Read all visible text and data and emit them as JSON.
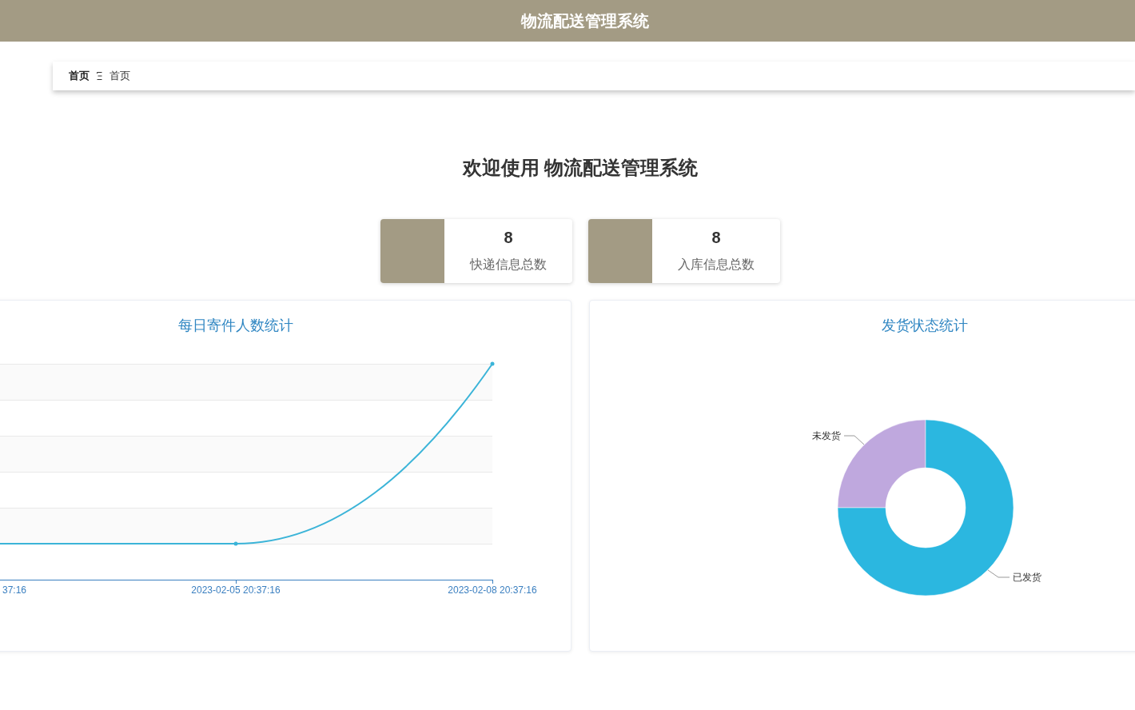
{
  "header": {
    "title": "物流配送管理系统"
  },
  "breadcrumb": {
    "items": [
      {
        "label": "首页",
        "kind": "link"
      },
      {
        "label": "首页",
        "kind": "current"
      }
    ]
  },
  "welcome": {
    "title": "欢迎使用 物流配送管理系统"
  },
  "stats": [
    {
      "value": "8",
      "label": "快递信息总数"
    },
    {
      "value": "8",
      "label": "入库信息总数"
    }
  ],
  "line_chart": {
    "title": "每日寄件人数统计",
    "x_labels": [
      "37:16",
      "2023-02-05 20:37:16",
      "2023-02-08 20:37:16"
    ]
  },
  "status_chart": {
    "title": "发货状态统计",
    "slices": [
      {
        "label": "未发货",
        "color": "#bfa8de"
      },
      {
        "label": "已发货",
        "color": "#2bb7e0"
      }
    ]
  }
}
